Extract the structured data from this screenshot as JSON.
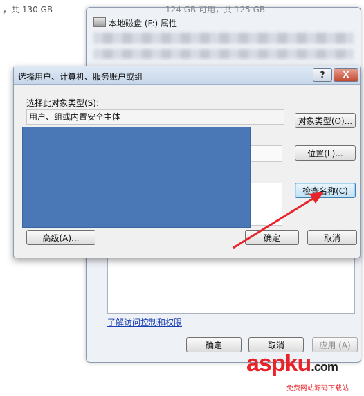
{
  "disk_info": "，共 130 GB",
  "props_window": {
    "header_text": "124 GB 可用，共 125 GB",
    "title": "本地磁盘 (F:) 属性",
    "link": "了解访问控制和权限",
    "ok": "确定",
    "cancel": "取消",
    "apply": "应用 (A)"
  },
  "dialog": {
    "title": "选择用户、计算机、服务账户或组",
    "help": "?",
    "close": "X",
    "object_type_label": "选择此对象类型(S):",
    "object_type_value": "用户、组或内置安全主体",
    "object_types_button": "对象类型(O)...",
    "locations_button": "位置(L)...",
    "check_names_button": "检查名称(C)",
    "advanced_button": "高级(A)...",
    "ok": "确定",
    "cancel": "取消"
  },
  "watermark": {
    "brand": "aspku",
    "tld": "com",
    "sub": "免费网站源码下载站"
  },
  "colors": {
    "redaction": "#4a78b6",
    "arrow": "#e8232a",
    "close_button": "#c44a32"
  }
}
